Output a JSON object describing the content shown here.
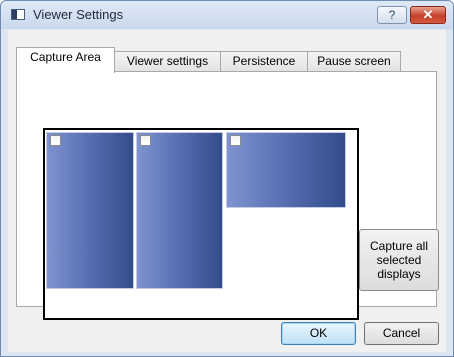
{
  "window": {
    "title": "Viewer Settings",
    "help_label": "?",
    "close_label": "✕"
  },
  "tabs": [
    {
      "label": "Capture Area",
      "active": true
    },
    {
      "label": "Viewer settings",
      "active": false
    },
    {
      "label": "Persistence",
      "active": false
    },
    {
      "label": "Pause screen",
      "active": false
    }
  ],
  "displays": [
    {
      "checked": false
    },
    {
      "checked": false
    },
    {
      "checked": false
    }
  ],
  "capture_button_label": "Capture all selected displays",
  "ok_label": "OK",
  "cancel_label": "Cancel",
  "colors": {
    "display_gradient_start": "#7f93cf",
    "display_gradient_end": "#324c8c",
    "close_button": "#c4402a"
  }
}
